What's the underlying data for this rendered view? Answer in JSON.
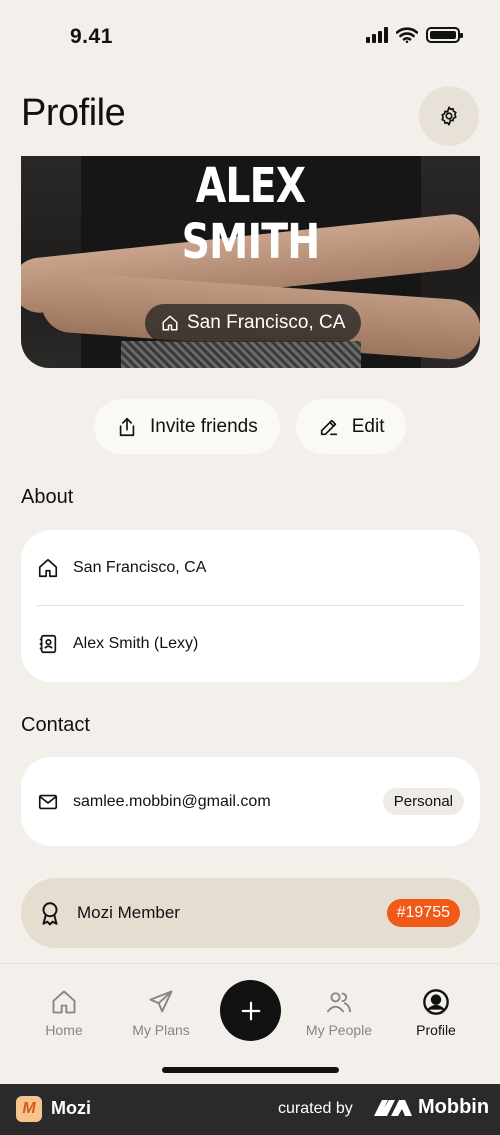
{
  "status_bar": {
    "time": "9.41"
  },
  "header": {
    "title": "Profile"
  },
  "hero": {
    "name_line1": "ALEX",
    "name_line2": "SMITH",
    "location": "San Francisco, CA"
  },
  "actions": {
    "invite_label": "Invite friends",
    "edit_label": "Edit"
  },
  "about": {
    "title": "About",
    "location": "San Francisco, CA",
    "name": "Alex Smith (Lexy)"
  },
  "contact": {
    "title": "Contact",
    "email": "samlee.mobbin@gmail.com",
    "email_type": "Personal"
  },
  "membership": {
    "label": "Mozi Member",
    "number": "#19755",
    "badge_color": "#f15a16"
  },
  "tabs": [
    {
      "label": "Home",
      "icon": "home-icon"
    },
    {
      "label": "My Plans",
      "icon": "plane-icon"
    },
    {
      "label": "My People",
      "icon": "people-icon"
    },
    {
      "label": "Profile",
      "icon": "profile-icon",
      "active": true
    }
  ],
  "footer": {
    "app_name": "Mozi",
    "curated_by": "curated by",
    "brand": "Mobbin",
    "logo_letter": "M"
  }
}
